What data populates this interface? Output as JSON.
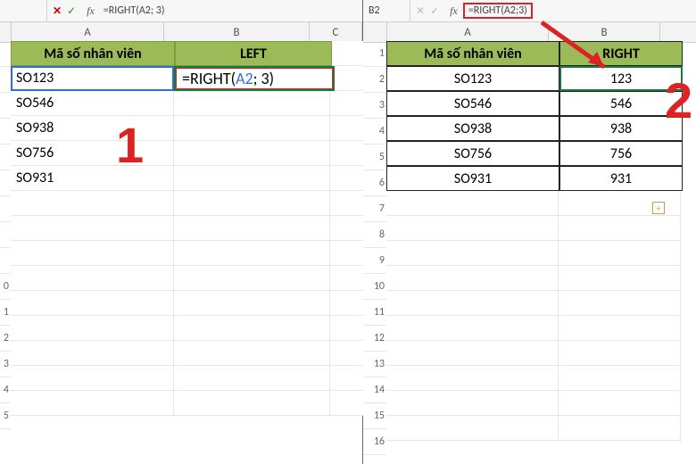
{
  "left": {
    "formula_bar": {
      "cancel": "✕",
      "confirm": "✓",
      "fx": "fx",
      "formula": "=RIGHT(A2; 3)"
    },
    "col_headers": [
      "A",
      "B",
      "C"
    ],
    "row_headers": [
      "",
      "",
      "",
      "",
      "",
      "",
      "",
      "",
      "",
      "0",
      "1",
      "2",
      "3",
      "4",
      "5"
    ],
    "header_row": {
      "a": "Mã số nhân viên",
      "b": "LEFT"
    },
    "rows": [
      {
        "a": "SO123",
        "b_formula_prefix": "=RIGHT(",
        "b_ref": "A2",
        "b_formula_suffix": "; 3)"
      },
      {
        "a": "SO546"
      },
      {
        "a": "SO938"
      },
      {
        "a": "SO756"
      },
      {
        "a": "SO931"
      }
    ],
    "badge": "1"
  },
  "right": {
    "formula_bar": {
      "namebox": "B2",
      "fx": "fx",
      "formula": "=RIGHT(A2;3)"
    },
    "col_headers": [
      "A",
      "B"
    ],
    "row_headers": [
      "1",
      "2",
      "3",
      "4",
      "5",
      "6",
      "7",
      "8",
      "9",
      "10",
      "11",
      "12",
      "13",
      "14",
      "15",
      "16"
    ],
    "header_row": {
      "a": "Mã số nhân viên",
      "b": "RIGHT"
    },
    "rows": [
      {
        "a": "SO123",
        "b": "123"
      },
      {
        "a": "SO546",
        "b": "546"
      },
      {
        "a": "SO938",
        "b": "938"
      },
      {
        "a": "SO756",
        "b": "756"
      },
      {
        "a": "SO931",
        "b": "931"
      }
    ],
    "badge": "2",
    "fill_glyph": "+"
  }
}
